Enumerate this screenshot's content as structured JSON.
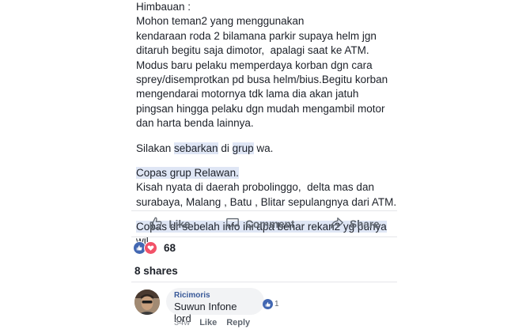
{
  "post": {
    "lines": [
      "Himbauan :",
      "Mohon teman2 yang menggunakan",
      "kendaraan roda 2 bilamana parkir supaya helm jgn",
      "ditaruh begitu saja dimotor,  apalagi saat ke ATM.",
      "Modus baru pelaku memperdaya korban dgn cara",
      "sprey/disemprotkan pd busa helm/bius.Begitu korban",
      "mengendarai motornya tdk lama dia akan jatuh",
      "pingsan hingga pelaku dgn mudah mengambil motor",
      "dan harta benda lainnya."
    ],
    "share_pre": "Silakan ",
    "share_hl1": "sebarkan",
    "share_mid": " di ",
    "share_hl2": "grup",
    "share_post": " wa.",
    "copas_relawan": "Copas grup Relawan.",
    "story_line1": "Kisah nyata di daerah probolinggo,  delta mas dan",
    "story_line2": "surabaya, Malang , Batu , Blitar sepulangnya dari ATM.",
    "copas_line1": "Copas dr sebelah info ini apa benar rekan2 yg punya",
    "copas_line2": "wil.."
  },
  "actions": {
    "like_label": "Like",
    "comment_label": "Comment",
    "share_label": "Share"
  },
  "reactions": {
    "count": "68"
  },
  "shares": {
    "text": "8 shares"
  },
  "comment": {
    "author": "Ricimoris",
    "text": "Suwun Infone lord",
    "like_count": "1",
    "time": "34w",
    "like_label": "Like",
    "reply_label": "Reply"
  },
  "colors": {
    "highlight": "#dfe6f5",
    "like_blue": "#4267b2",
    "love_red": "#f25268",
    "muted": "#606770"
  },
  "icons": [
    "thumbs-up-icon",
    "comment-bubble-icon",
    "share-arrow-icon",
    "like-reaction-icon",
    "love-reaction-icon"
  ]
}
